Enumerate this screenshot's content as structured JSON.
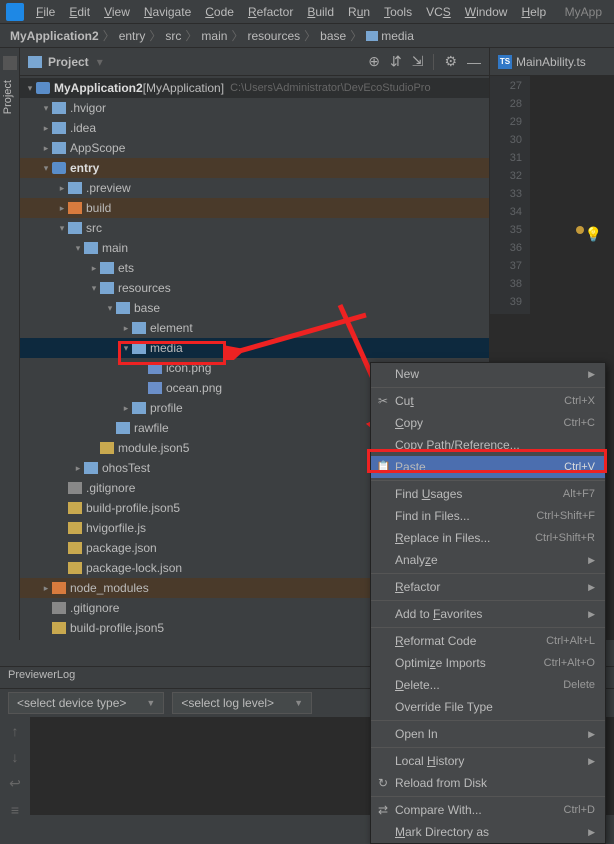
{
  "menubar": {
    "items": [
      "File",
      "Edit",
      "View",
      "Navigate",
      "Code",
      "Refactor",
      "Build",
      "Run",
      "Tools",
      "VCS",
      "Window",
      "Help"
    ],
    "right": "MyApp"
  },
  "breadcrumb": {
    "parts": [
      "MyApplication2",
      "entry",
      "src",
      "main",
      "resources",
      "base",
      "media"
    ]
  },
  "project_panel": {
    "title": "Project"
  },
  "tree": {
    "root": {
      "name": "MyApplication2",
      "bracket": "[MyApplication]",
      "path": "C:\\Users\\Administrator\\DevEcoStudioPro"
    },
    "nodes": [
      {
        "d": 1,
        "n": ".hvigor",
        "c": "v"
      },
      {
        "d": 1,
        "n": ".idea",
        "c": ">"
      },
      {
        "d": 1,
        "n": "AppScope",
        "c": ">"
      },
      {
        "d": 1,
        "n": "entry",
        "c": "v",
        "mod": true,
        "hl": true
      },
      {
        "d": 2,
        "n": ".preview",
        "c": ">"
      },
      {
        "d": 2,
        "n": "build",
        "c": ">",
        "hl": true
      },
      {
        "d": 2,
        "n": "src",
        "c": "v"
      },
      {
        "d": 3,
        "n": "main",
        "c": "v"
      },
      {
        "d": 4,
        "n": "ets",
        "c": ">"
      },
      {
        "d": 4,
        "n": "resources",
        "c": "v"
      },
      {
        "d": 5,
        "n": "base",
        "c": "v"
      },
      {
        "d": 6,
        "n": "element",
        "c": ">"
      },
      {
        "d": 6,
        "n": "media",
        "c": "v",
        "sel": true
      },
      {
        "d": 7,
        "n": "icon.png",
        "t": "img"
      },
      {
        "d": 7,
        "n": "ocean.png",
        "t": "img"
      },
      {
        "d": 6,
        "n": "profile",
        "c": ">"
      },
      {
        "d": 5,
        "n": "rawfile",
        "c": ""
      },
      {
        "d": 4,
        "n": "module.json5",
        "t": "json"
      },
      {
        "d": 3,
        "n": "ohosTest",
        "c": ">"
      },
      {
        "d": 2,
        "n": ".gitignore",
        "t": "git"
      },
      {
        "d": 2,
        "n": "build-profile.json5",
        "t": "json"
      },
      {
        "d": 2,
        "n": "hvigorfile.js",
        "t": "js"
      },
      {
        "d": 2,
        "n": "package.json",
        "t": "json"
      },
      {
        "d": 2,
        "n": "package-lock.json",
        "t": "json"
      },
      {
        "d": 1,
        "n": "node_modules",
        "c": ">",
        "hl": true
      },
      {
        "d": 1,
        "n": ".gitignore",
        "t": "git"
      },
      {
        "d": 1,
        "n": "build-profile.json5",
        "t": "json"
      }
    ]
  },
  "editor": {
    "tab": "MainAbility.ts",
    "lines": [
      "27",
      "28",
      "29",
      "30",
      "31",
      "32",
      "33",
      "34",
      "35",
      "36",
      "37",
      "38",
      "39"
    ]
  },
  "context_menu": {
    "groups": [
      [
        {
          "l": "New",
          "sub": true
        }
      ],
      [
        {
          "l": "Cut",
          "s": "Ctrl+X",
          "ic": "✂",
          "u": "t"
        },
        {
          "l": "Copy",
          "s": "Ctrl+C",
          "u": "C"
        },
        {
          "l": "Copy Path/Reference..."
        },
        {
          "l": "Paste",
          "s": "Ctrl+V",
          "ic": "📋",
          "hl": true,
          "u": "P"
        }
      ],
      [
        {
          "l": "Find Usages",
          "s": "Alt+F7",
          "u": "U"
        },
        {
          "l": "Find in Files...",
          "s": "Ctrl+Shift+F"
        },
        {
          "l": "Replace in Files...",
          "s": "Ctrl+Shift+R",
          "u": "R"
        },
        {
          "l": "Analyze",
          "sub": true,
          "u": "z"
        }
      ],
      [
        {
          "l": "Refactor",
          "sub": true,
          "u": "R"
        }
      ],
      [
        {
          "l": "Add to Favorites",
          "sub": true,
          "u": "F"
        }
      ],
      [
        {
          "l": "Reformat Code",
          "s": "Ctrl+Alt+L",
          "u": "R"
        },
        {
          "l": "Optimize Imports",
          "s": "Ctrl+Alt+O",
          "u": "z"
        },
        {
          "l": "Delete...",
          "s": "Delete",
          "u": "D"
        },
        {
          "l": "Override File Type"
        }
      ],
      [
        {
          "l": "Open In",
          "sub": true
        }
      ],
      [
        {
          "l": "Local History",
          "sub": true,
          "u": "H"
        },
        {
          "l": "Reload from Disk",
          "ic": "↻"
        }
      ],
      [
        {
          "l": "Compare With...",
          "s": "Ctrl+D",
          "ic": "⇄"
        },
        {
          "l": "Mark Directory as",
          "sub": true,
          "u": "M"
        }
      ]
    ]
  },
  "bottom": {
    "tab": "PreviewerLog",
    "selectors": [
      "<select device type>",
      "<select log level>"
    ]
  }
}
